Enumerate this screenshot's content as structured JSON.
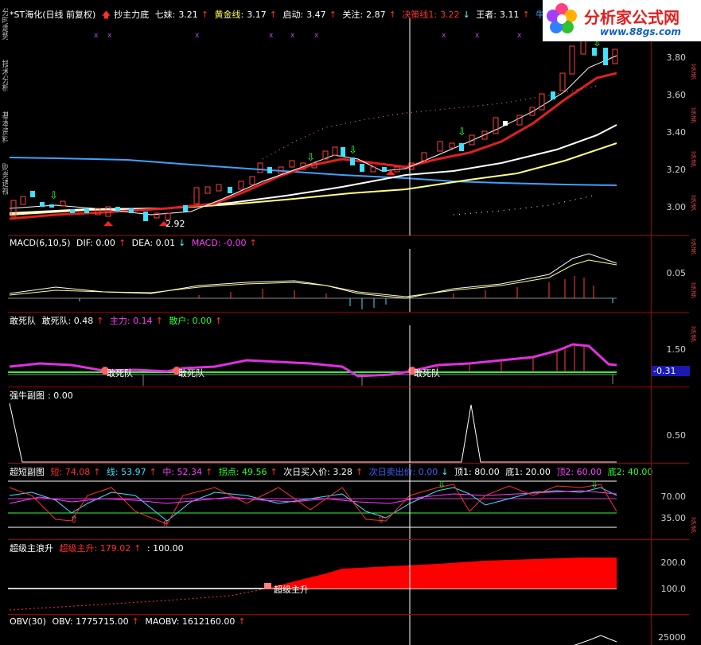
{
  "side_tabs": [
    "分时走势",
    "技术分析",
    "基本资料",
    "财务透视"
  ],
  "right_tabs": [
    "买卖",
    "买卖",
    "买卖",
    "买卖",
    "买卖",
    "买卖",
    "买卖",
    "买卖"
  ],
  "logo": {
    "title": "分析家公式网",
    "url": "www.88gs.com"
  },
  "main": {
    "stock": "*ST海化(日线 前复权)",
    "indicators": [
      {
        "label": "抄主力底",
        "value": "",
        "color": "#ff3030"
      },
      {
        "label": "七妹:",
        "value": "3.21",
        "color": "#ffffff"
      },
      {
        "label": "黄金线:",
        "value": "3.17",
        "color": "#ffff60"
      },
      {
        "label": "启动:",
        "value": "3.47",
        "color": "#ffffff"
      },
      {
        "label": "关注:",
        "value": "2.87",
        "color": "#ffffff"
      },
      {
        "label": "决策线1:",
        "value": "3.22",
        "color": "#ff3030"
      },
      {
        "label": "王者:",
        "value": "3.11",
        "color": "#ffffff"
      },
      {
        "label": "牛熊",
        "value": "",
        "color": "#40a0ff"
      }
    ],
    "y_labels": [
      "3.80",
      "3.60",
      "3.40",
      "3.20",
      "3.00"
    ],
    "low_label": "2.92"
  },
  "macd": {
    "title": "MACD(6,10,5)",
    "dif": "DIF: 0.00",
    "dea": "DEA: 0.01",
    "macd": "MACD: -0.00",
    "y_label": "0.05"
  },
  "dare": {
    "title": "敢死队",
    "v1": "敢死队: 0.48",
    "v2": "主力: 0.14",
    "v3": "散户: 0.00",
    "y_label": "1.50",
    "current": "-0.31",
    "markers": [
      "敢死队",
      "敢死队",
      "敢死队"
    ]
  },
  "bull": {
    "title": "强牛副图",
    "value": ": 0.00",
    "y_label": "0.50"
  },
  "short": {
    "title": "超短副图",
    "v1": "短: 74.08",
    "v2": "线: 53.97",
    "v3": "中: 52.34",
    "v4": "拐点: 49.56",
    "v5": "次日买入价: 3.28",
    "v6": "次日卖出价: 0.00",
    "v7": "顶1: 80.00",
    "v8": "底1: 20.00",
    "v9": "顶2: 60.00",
    "v10": "底2: 40.00",
    "y_labels": [
      "70.00",
      "35.00"
    ]
  },
  "wave": {
    "title": "超级主浪升",
    "v1": "超级主升: 179.02",
    "v2": ": 100.00",
    "y_labels": [
      "200.0",
      "100.0"
    ],
    "marker": "超级主升"
  },
  "obv": {
    "title": "OBV(30)",
    "v1": "OBV: 1775715.00",
    "v2": "MAOBV: 1612160.00",
    "y_label": "25000"
  }
}
